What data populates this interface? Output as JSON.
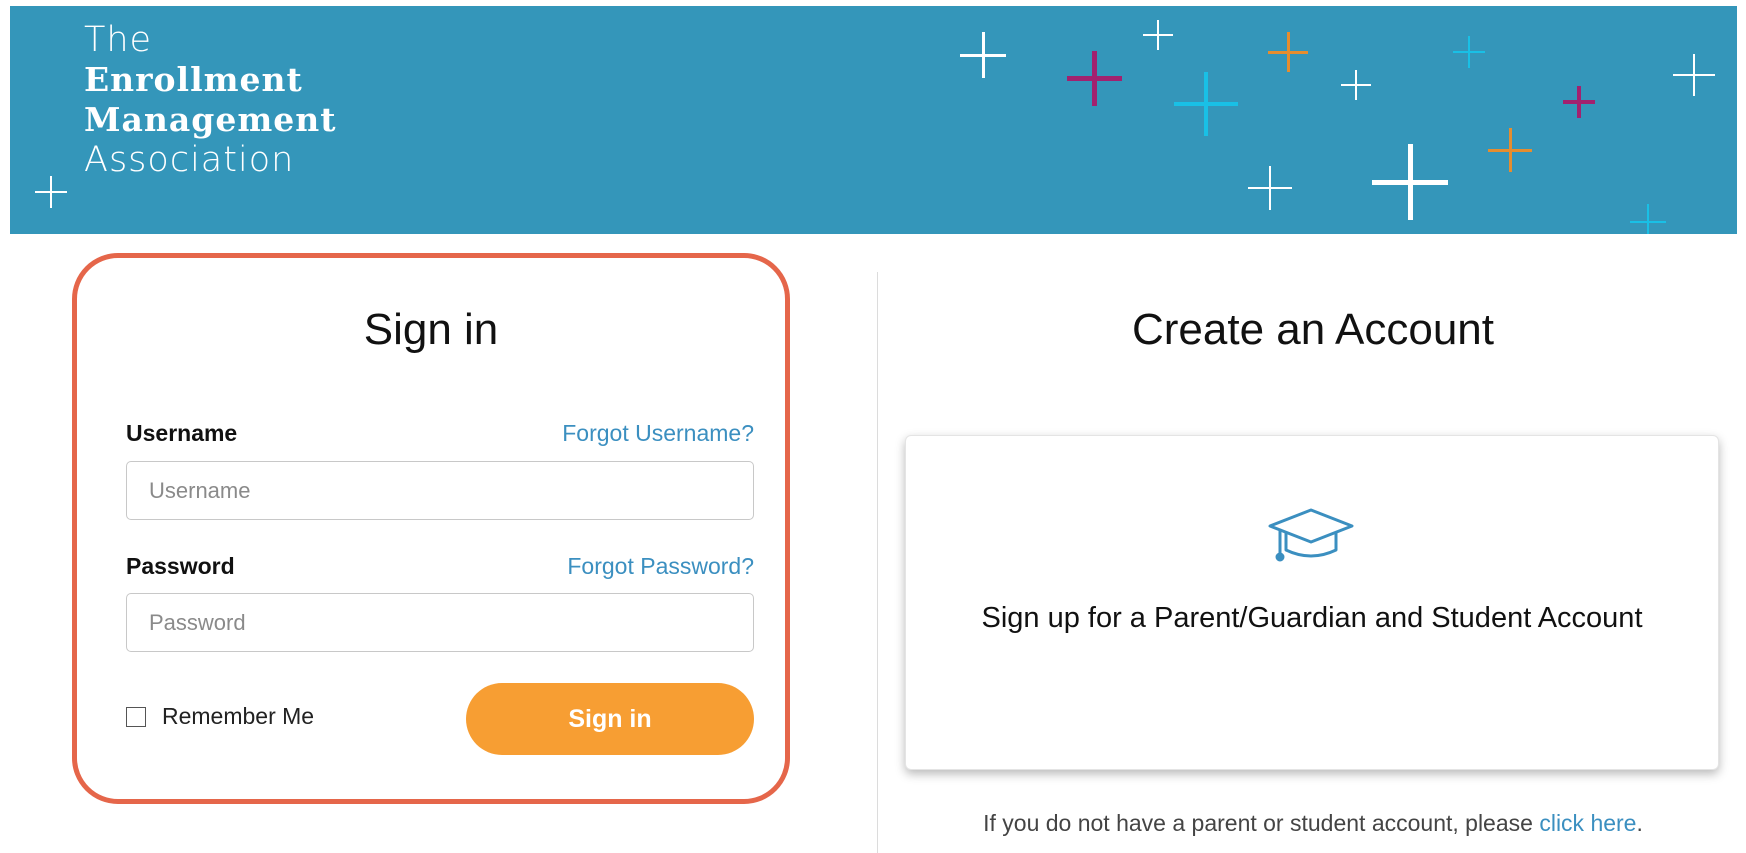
{
  "header": {
    "logo_line1": "The",
    "logo_line2": "Enrollment",
    "logo_line3": "Management",
    "logo_line4": "Association",
    "background_color": "#3496ba",
    "decor_colors": [
      "#ffffff",
      "#a2216f",
      "#19c0e6",
      "#e58d2f"
    ]
  },
  "signin": {
    "title": "Sign in",
    "username_label": "Username",
    "forgot_username": "Forgot Username?",
    "username_placeholder": "Username",
    "password_label": "Password",
    "forgot_password": "Forgot Password?",
    "password_placeholder": "Password",
    "remember_label": "Remember Me",
    "remember_checked": false,
    "button_label": "Sign in",
    "button_color": "#f79e33",
    "highlight_color": "#e5664a"
  },
  "create": {
    "title": "Create an Account",
    "card_icon": "graduation-cap-icon",
    "card_text": "Sign up for a Parent/Guardian and Student Account",
    "footnote_prefix": "If you do not have a parent or student account, please ",
    "footnote_link": "click here",
    "footnote_suffix": ".",
    "link_color": "#3b8fc0"
  }
}
